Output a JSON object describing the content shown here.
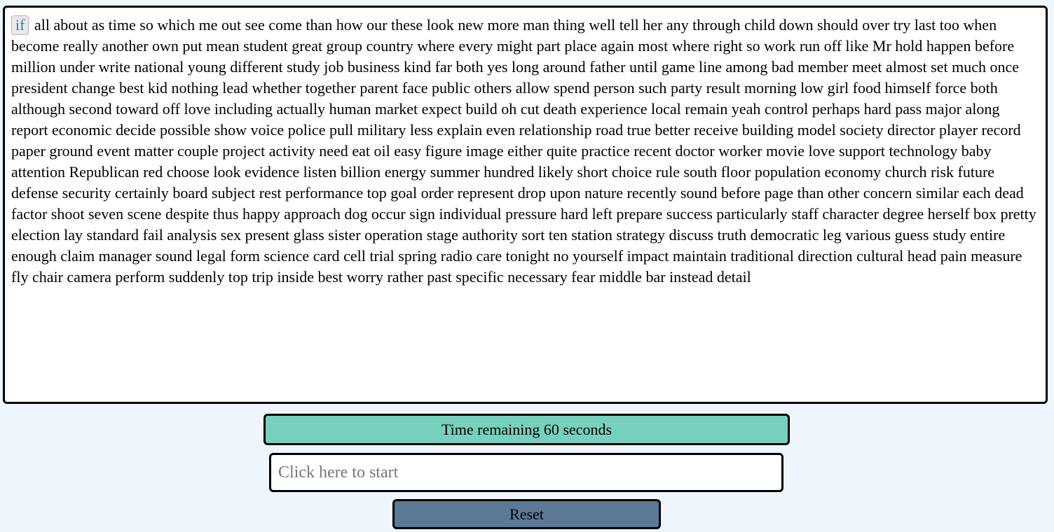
{
  "words": [
    "if",
    "all",
    "about",
    "as",
    "time",
    "so",
    "which",
    "me",
    "out",
    "see",
    "come",
    "than",
    "how",
    "our",
    "these",
    "look",
    "new",
    "more",
    "man",
    "thing",
    "well",
    "tell",
    "her",
    "any",
    "through",
    "child",
    "down",
    "should",
    "over",
    "try",
    "last",
    "too",
    "when",
    "become",
    "really",
    "another",
    "own",
    "put",
    "mean",
    "student",
    "great",
    "group",
    "country",
    "where",
    "every",
    "might",
    "part",
    "place",
    "again",
    "most",
    "where",
    "right",
    "so",
    "work",
    "run",
    "off",
    "like",
    "Mr",
    "hold",
    "happen",
    "before",
    "million",
    "under",
    "write",
    "national",
    "young",
    "different",
    "study",
    "job",
    "business",
    "kind",
    "far",
    "both",
    "yes",
    "long",
    "around",
    "father",
    "until",
    "game",
    "line",
    "among",
    "bad",
    "member",
    "meet",
    "almost",
    "set",
    "much",
    "once",
    "president",
    "change",
    "best",
    "kid",
    "nothing",
    "lead",
    "whether",
    "together",
    "parent",
    "face",
    "public",
    "others",
    "allow",
    "spend",
    "person",
    "such",
    "party",
    "result",
    "morning",
    "low",
    "girl",
    "food",
    "himself",
    "force",
    "both",
    "although",
    "second",
    "toward",
    "off",
    "love",
    "including",
    "actually",
    "human",
    "market",
    "expect",
    "build",
    "oh",
    "cut",
    "death",
    "experience",
    "local",
    "remain",
    "yeah",
    "control",
    "perhaps",
    "hard",
    "pass",
    "major",
    "along",
    "report",
    "economic",
    "decide",
    "possible",
    "show",
    "voice",
    "police",
    "pull",
    "military",
    "less",
    "explain",
    "even",
    "relationship",
    "road",
    "true",
    "better",
    "receive",
    "building",
    "model",
    "society",
    "director",
    "player",
    "record",
    "paper",
    "ground",
    "event",
    "matter",
    "couple",
    "project",
    "activity",
    "need",
    "eat",
    "oil",
    "easy",
    "figure",
    "image",
    "either",
    "quite",
    "practice",
    "recent",
    "doctor",
    "worker",
    "movie",
    "love",
    "support",
    "technology",
    "baby",
    "attention",
    "Republican",
    "red",
    "choose",
    "look",
    "evidence",
    "listen",
    "billion",
    "energy",
    "summer",
    "hundred",
    "likely",
    "short",
    "choice",
    "rule",
    "south",
    "floor",
    "population",
    "economy",
    "church",
    "risk",
    "future",
    "defense",
    "security",
    "certainly",
    "board",
    "subject",
    "rest",
    "performance",
    "top",
    "goal",
    "order",
    "represent",
    "drop",
    "upon",
    "nature",
    "recently",
    "sound",
    "before",
    "page",
    "than",
    "other",
    "concern",
    "similar",
    "each",
    "dead",
    "factor",
    "shoot",
    "seven",
    "scene",
    "despite",
    "thus",
    "happy",
    "approach",
    "dog",
    "occur",
    "sign",
    "individual",
    "pressure",
    "hard",
    "left",
    "prepare",
    "success",
    "particularly",
    "staff",
    "character",
    "degree",
    "herself",
    "box",
    "pretty",
    "election",
    "lay",
    "standard",
    "fail",
    "analysis",
    "sex",
    "present",
    "glass",
    "sister",
    "operation",
    "stage",
    "authority",
    "sort",
    "ten",
    "station",
    "strategy",
    "discuss",
    "truth",
    "democratic",
    "leg",
    "various",
    "guess",
    "study",
    "entire",
    "enough",
    "claim",
    "manager",
    "sound",
    "legal",
    "form",
    "science",
    "card",
    "cell",
    "trial",
    "spring",
    "radio",
    "care",
    "tonight",
    "no",
    "yourself",
    "impact",
    "maintain",
    "traditional",
    "direction",
    "cultural",
    "head",
    "pain",
    "measure",
    "fly",
    "chair",
    "camera",
    "perform",
    "suddenly",
    "top",
    "trip",
    "inside",
    "best",
    "worry",
    "rather",
    "past",
    "specific",
    "necessary",
    "fear",
    "middle",
    "bar",
    "instead",
    "detail"
  ],
  "current_word_index": 0,
  "timer": {
    "label": "Time remaining 60 seconds"
  },
  "input": {
    "placeholder": "Click here to start",
    "value": ""
  },
  "reset": {
    "label": "Reset"
  },
  "colors": {
    "background": "#eef5fd",
    "timer_bg": "#76d0bd",
    "reset_bg": "#5b7996",
    "current_word_text": "#2a7fa8"
  }
}
